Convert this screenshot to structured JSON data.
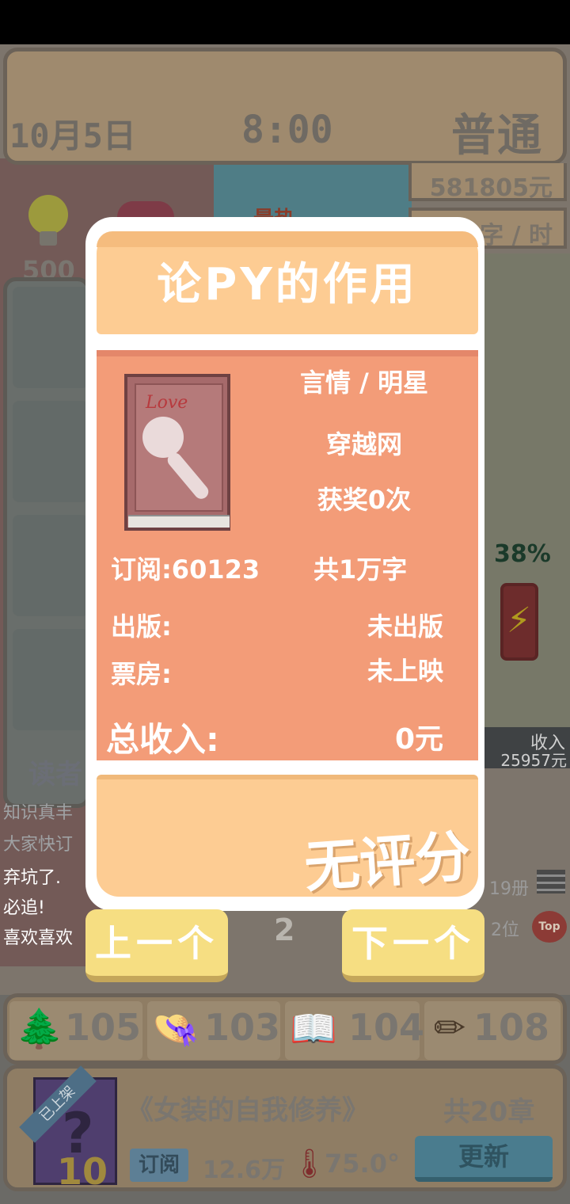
{
  "header": {
    "date": "10月5日",
    "time": "8:00",
    "difficulty": "普通",
    "money": "581805元",
    "speed": "字 / 时"
  },
  "resources": {
    "ideas": "500",
    "hot_label": "最热"
  },
  "background": {
    "reader_label": "读者",
    "progress_pct": "38%",
    "income_label": "收入",
    "income_value": "25957元",
    "feed": [
      "知识真丰",
      "大家快订",
      "弃坑了.",
      "必追!",
      "喜欢喜欢"
    ],
    "shelf_count": "19册",
    "rank": "2位",
    "top_label": "Top",
    "page": "2"
  },
  "dialog": {
    "title": "论PY的作用",
    "genre": "言情 / 明星",
    "site": "穿越网",
    "awards": "获奖0次",
    "subscriptions": "订阅:60123",
    "word_count": "共1万字",
    "publish_label": "出版:",
    "publish_value": "未出版",
    "boxoffice_label": "票房:",
    "boxoffice_value": "未上映",
    "total_label": "总收入:",
    "total_value": "0元",
    "rating": "无评分",
    "cover_scribble": "Love"
  },
  "nav": {
    "prev": "上一个",
    "next": "下一个"
  },
  "stats": [
    {
      "icon": "tree-icon",
      "glyph": "🌲",
      "value": "105"
    },
    {
      "icon": "hat-woman-icon",
      "glyph": "👒",
      "value": "103"
    },
    {
      "icon": "open-book-icon",
      "glyph": "📖",
      "value": "104"
    },
    {
      "icon": "pencil-icon",
      "glyph": "✏",
      "value": "108"
    }
  ],
  "current_book": {
    "shelf_ribbon": "已上架",
    "cover_number": "10",
    "title": "《女装的自我修养》",
    "chapters": "共20章",
    "sub_label": "订阅",
    "sub_count": "12.6万",
    "rating": "75.0°",
    "update_button": "更新"
  },
  "colors": {
    "dialog_header": "#fdcc93",
    "dialog_body": "#f39c78",
    "nav_button": "#f6de82"
  }
}
